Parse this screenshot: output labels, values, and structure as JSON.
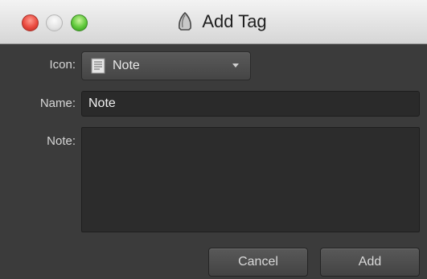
{
  "window": {
    "title": "Add Tag",
    "title_icon": "tag-icon"
  },
  "form": {
    "icon_label": "Icon:",
    "icon_value": "Note",
    "icon_glyph": "note-icon",
    "name_label": "Name:",
    "name_value": "Note",
    "note_label": "Note:",
    "note_value": ""
  },
  "buttons": {
    "cancel_label": "Cancel",
    "add_label": "Add"
  },
  "colors": {
    "window_bg": "#3b3b3b",
    "close": "#e9493e",
    "minimize": "#e3e3e3",
    "zoom": "#5fc83a"
  }
}
